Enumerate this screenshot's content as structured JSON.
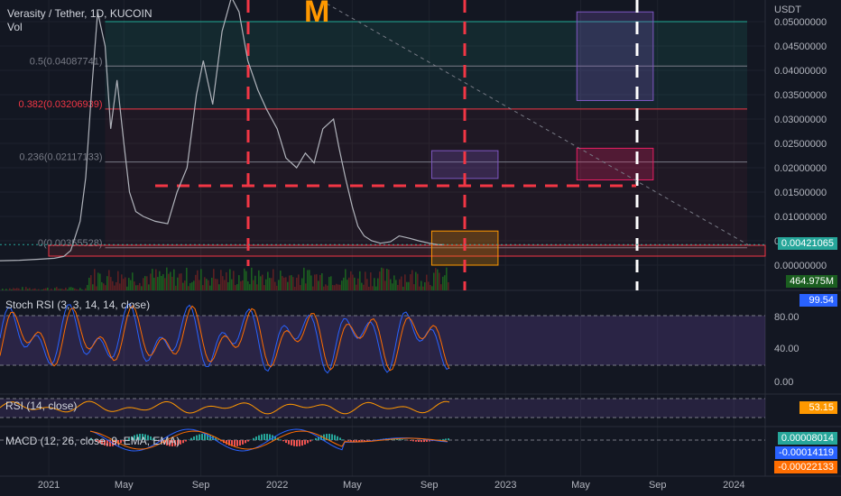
{
  "header": {
    "symbol": "Verasity / Tether, 1D, KUCOIN",
    "vol_label": "Vol",
    "currency": "USDT",
    "logo_letter": "M"
  },
  "colors": {
    "background": "#131722",
    "up": "#26a69a",
    "down": "#ef5350",
    "fib_blue": "#22ab94",
    "fib_red": "#f23645",
    "zone_purple": "#7e57c2",
    "zone_orange": "#ff9800",
    "rsi_line": "#ff9800",
    "stoch_k": "#2962ff",
    "stoch_d": "#ff6d00",
    "logo": "#ff9800"
  },
  "fib_levels": [
    {
      "label": "0.5(0.04087741)",
      "value": 0.04087741,
      "color": "#787b86"
    },
    {
      "label": "0.382(0.03206939)",
      "value": 0.03206939,
      "color": "#f23645"
    },
    {
      "label": "0.236(0.02117133)",
      "value": 0.02117133,
      "color": "#787b86"
    },
    {
      "label": "0(0.00355528)",
      "value": 0.00355528,
      "color": "#787b86"
    }
  ],
  "price_badge": {
    "value": "0.00421065",
    "color": "#26a69a"
  },
  "volume_badge": {
    "value": "464.975M",
    "color": "#1b5e20"
  },
  "panes": {
    "stoch": {
      "label": "Stoch RSI (3, 3, 14, 14, close)",
      "badge": "99.54",
      "badge_color": "#2962ff",
      "ticks": [
        "80.00",
        "40.00",
        "0.00"
      ]
    },
    "rsi": {
      "label": "RSI (14, close)",
      "badge": "53.15",
      "badge_color": "#ff9800"
    },
    "macd": {
      "label": "MACD (12, 26, close, 9, EMA, EMA)",
      "badges": [
        {
          "value": "0.00008014",
          "color": "#26a69a"
        },
        {
          "value": "-0.00014119",
          "color": "#2962ff"
        },
        {
          "value": "-0.00022133",
          "color": "#ff6d00"
        }
      ]
    }
  },
  "chart_data": {
    "type": "line",
    "title": "Verasity / Tether, 1D, KUCOIN",
    "ylabel": "USDT",
    "y_scale": "linear",
    "ylim": [
      -0.002,
      0.05
    ],
    "y_ticks": [
      0.05,
      0.045,
      0.04,
      0.035,
      0.03,
      0.025,
      0.02,
      0.015,
      0.01,
      0.005,
      0.0
    ],
    "y_tick_labels": [
      "0.05000000",
      "0.04500000",
      "0.04000000",
      "0.03500000",
      "0.03000000",
      "0.02500000",
      "0.02000000",
      "0.01500000",
      "0.01000000",
      "0.00500000",
      "0.00000000"
    ],
    "x_tick_labels": [
      "2021",
      "May",
      "Sep",
      "2022",
      "May",
      "Sep",
      "2023",
      "May",
      "Sep",
      "2024"
    ],
    "x_tick_dates": [
      "2021-01-01",
      "2021-05-01",
      "2021-09-01",
      "2022-01-01",
      "2022-05-01",
      "2022-09-01",
      "2023-01-01",
      "2023-05-01",
      "2023-09-01",
      "2024-01-01"
    ],
    "series": [
      {
        "values_dates": [
          "2020-10-15",
          "2020-11-15",
          "2020-12-15",
          "2021-01-10",
          "2021-01-25",
          "2021-02-05",
          "2021-02-20",
          "2021-03-01",
          "2021-03-10",
          "2021-03-20",
          "2021-04-01",
          "2021-04-10",
          "2021-04-20",
          "2021-05-01",
          "2021-05-10",
          "2021-05-20",
          "2021-06-01",
          "2021-06-20",
          "2021-07-10",
          "2021-07-25",
          "2021-08-10",
          "2021-08-25",
          "2021-09-05",
          "2021-09-20",
          "2021-10-05",
          "2021-10-20",
          "2021-11-01",
          "2021-11-15",
          "2021-12-01",
          "2021-12-15",
          "2022-01-01",
          "2022-01-15",
          "2022-02-01",
          "2022-02-15",
          "2022-03-01",
          "2022-03-15",
          "2022-04-01",
          "2022-04-10",
          "2022-04-20",
          "2022-05-01",
          "2022-05-10",
          "2022-05-20",
          "2022-06-01",
          "2022-06-15",
          "2022-07-01",
          "2022-07-15",
          "2022-08-01",
          "2022-08-15",
          "2022-09-01",
          "2022-09-15",
          "2022-09-25"
        ],
        "values": [
          0.0009,
          0.001,
          0.0012,
          0.0014,
          0.0018,
          0.003,
          0.009,
          0.018,
          0.035,
          0.052,
          0.045,
          0.028,
          0.038,
          0.025,
          0.015,
          0.011,
          0.01,
          0.009,
          0.0085,
          0.015,
          0.02,
          0.035,
          0.042,
          0.033,
          0.048,
          0.055,
          0.052,
          0.042,
          0.036,
          0.032,
          0.028,
          0.022,
          0.02,
          0.023,
          0.021,
          0.028,
          0.03,
          0.024,
          0.018,
          0.012,
          0.008,
          0.006,
          0.005,
          0.0045,
          0.0048,
          0.006,
          0.0055,
          0.005,
          0.0045,
          0.0042,
          0.0042
        ]
      }
    ],
    "zones": [
      {
        "from": "2022-09-05",
        "to": "2022-12-20",
        "top": 0.0235,
        "bottom": 0.0178,
        "color": "#7e57c2"
      },
      {
        "from": "2023-04-25",
        "to": "2023-08-25",
        "top": 0.024,
        "bottom": 0.0175,
        "color": "#e91e63"
      },
      {
        "from": "2023-04-25",
        "to": "2023-08-25",
        "top": 0.052,
        "bottom": 0.0338,
        "color": "#7e57c2"
      },
      {
        "from": "2022-09-05",
        "to": "2022-12-20",
        "top": 0.007,
        "bottom": 0.0,
        "color": "#ff9800"
      }
    ]
  }
}
